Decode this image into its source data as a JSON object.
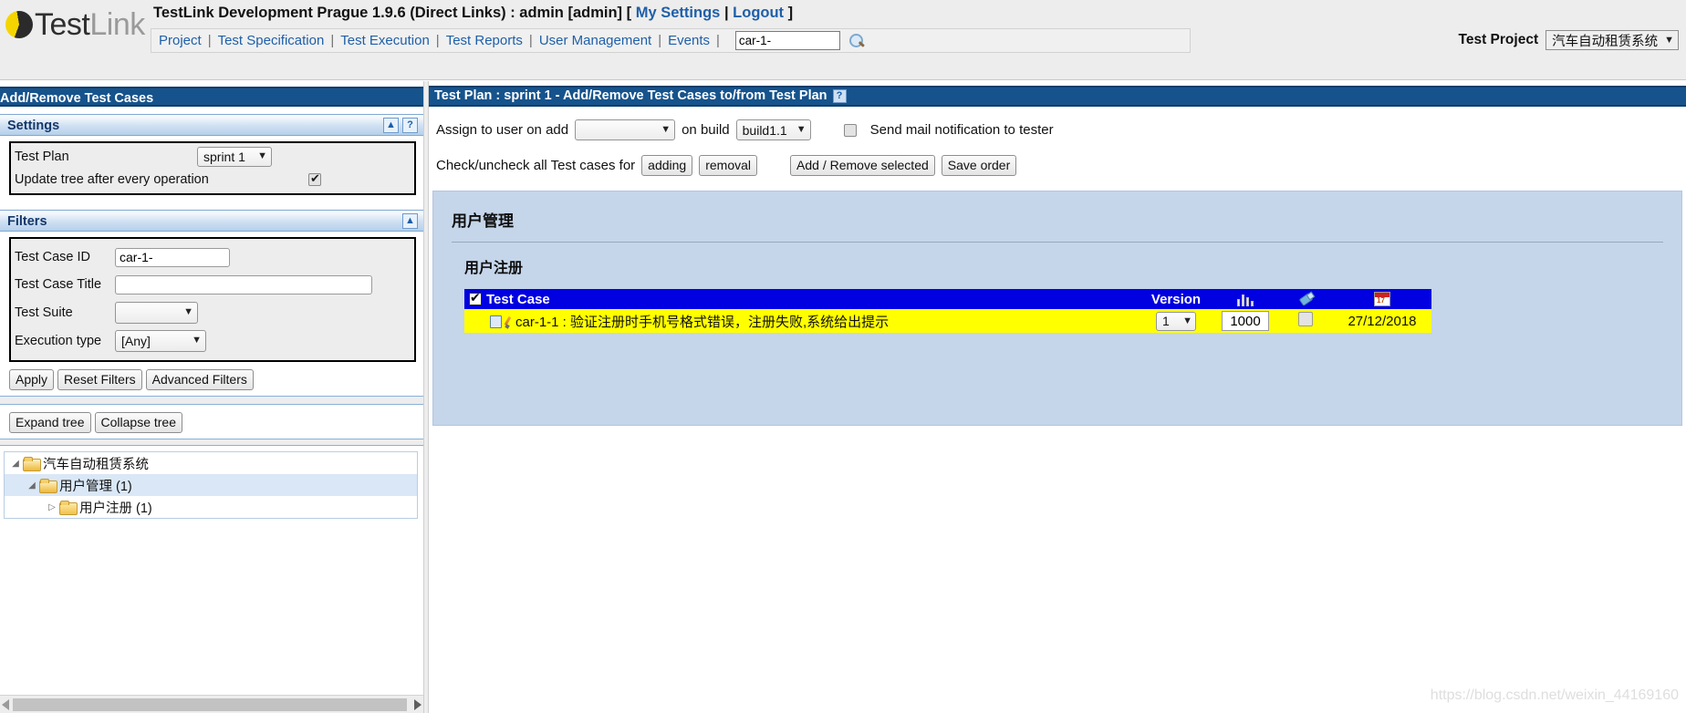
{
  "header": {
    "logo_text_bold": "Test",
    "logo_text_light": "Link",
    "title": "TestLink Development Prague 1.9.6 (Direct Links) : admin [admin] [",
    "my_settings": "My Settings",
    "title_pipe": "|",
    "logout": "Logout",
    "title_close": "]",
    "menu": [
      "Project",
      "Test Specification",
      "Test Execution",
      "Test Reports",
      "User Management",
      "Events"
    ],
    "search_value": "car-1-",
    "search_icon": "search-icon",
    "test_project_label": "Test Project",
    "test_project_value": "汽车自动租赁系统",
    "caret": "▼"
  },
  "left_panel": {
    "panel_title": "Add/Remove Test Cases",
    "settings": {
      "heading": "Settings",
      "collapse_icon": "▲",
      "help_icon": "?",
      "test_plan_label": "Test Plan",
      "test_plan_value": "sprint 1",
      "update_tree_label": "Update tree after every operation",
      "update_tree_checked": true
    },
    "filters": {
      "heading": "Filters",
      "collapse_icon": "▲",
      "test_case_id_label": "Test Case ID",
      "test_case_id_value": "car-1-",
      "test_case_title_label": "Test Case Title",
      "test_case_title_value": "",
      "test_suite_label": "Test Suite",
      "test_suite_value": "",
      "execution_type_label": "Execution type",
      "execution_type_value": "[Any]",
      "apply_button": "Apply",
      "reset_button": "Reset Filters",
      "advanced_button": "Advanced Filters"
    },
    "tree_buttons": {
      "expand": "Expand tree",
      "collapse": "Collapse tree"
    },
    "tree": [
      {
        "label": "汽车自动租赁系统",
        "twisty": "◢",
        "depth": 0,
        "selected": false
      },
      {
        "label": "用户管理 (1)",
        "twisty": "◢",
        "depth": 1,
        "selected": true
      },
      {
        "label": "用户注册 (1)",
        "twisty": "▷",
        "depth": 2,
        "selected": false
      }
    ]
  },
  "right_panel": {
    "title": "Test Plan : sprint 1 - Add/Remove Test Cases to/from Test Plan",
    "help_icon": "?",
    "assign_label": "Assign to user on add",
    "assign_value": "",
    "on_build_label": "on build",
    "build_value": "build1.1",
    "send_mail_label": "Send mail notification to tester",
    "send_mail_checked": false,
    "check_uncheck_label": "Check/uncheck all Test cases for",
    "adding_button": "adding",
    "removal_button": "removal",
    "add_remove_button": "Add / Remove selected",
    "save_order_button": "Save order",
    "suite_title": "用户管理",
    "sub_suite_title": "用户注册",
    "table": {
      "header_checkbox_checked": true,
      "col_test_case": "Test Case",
      "col_version": "Version",
      "col_bars_icon": "bar-chart-icon",
      "col_plug_icon": "plug-icon",
      "col_calendar_icon": "calendar-icon",
      "rows": [
        {
          "doc_icon": "document-icon",
          "edit_icon": "pencil-icon",
          "name": "car-1-1 : 验证注册时手机号格式错误，注册失败,系统给出提示",
          "version": "1",
          "priority": "1000",
          "checked": false,
          "date": "27/12/2018"
        }
      ]
    }
  },
  "watermark": "https://blog.csdn.net/weixin_44169160"
}
